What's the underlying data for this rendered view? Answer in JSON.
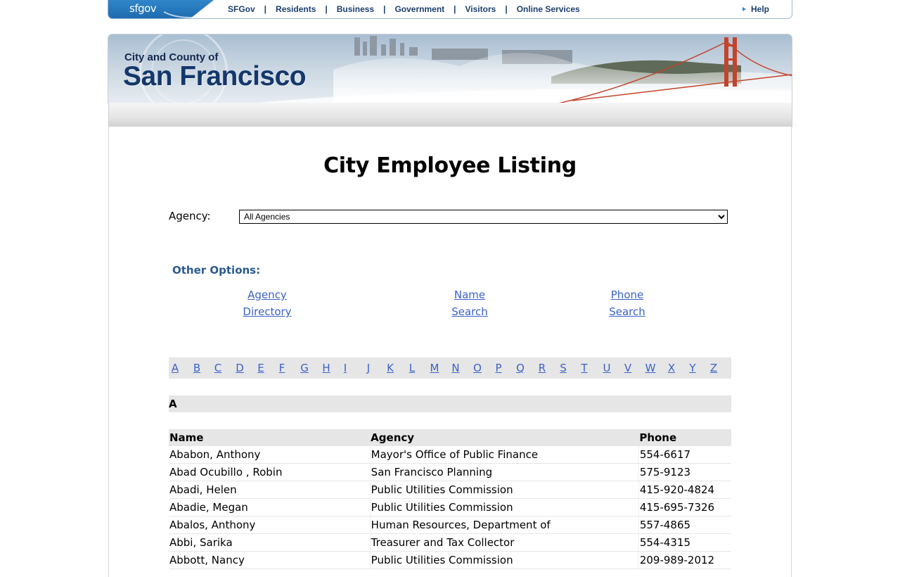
{
  "topnav": {
    "logo_text": "sfgov",
    "items": [
      "SFGov",
      "Residents",
      "Business",
      "Government",
      "Visitors",
      "Online Services"
    ],
    "separator": "|",
    "help_label": "Help"
  },
  "banner": {
    "small_title": "City and County of",
    "big_title": "San Francisco"
  },
  "main": {
    "title": "City Employee Listing",
    "agency_label": "Agency:",
    "agency_selected": "All Agencies",
    "other_options_label": "Other Options:",
    "options": [
      {
        "line1": "Agency",
        "line2": "Directory"
      },
      {
        "line1": "Name",
        "line2": "Search"
      },
      {
        "line1": "Phone",
        "line2": "Search"
      }
    ],
    "alphabet": [
      "A",
      "B",
      "C",
      "D",
      "E",
      "F",
      "G",
      "H",
      "I",
      "J",
      "K",
      "L",
      "M",
      "N",
      "O",
      "P",
      "Q",
      "R",
      "S",
      "T",
      "U",
      "V",
      "W",
      "X",
      "Y",
      "Z"
    ],
    "section_letter": "A",
    "table": {
      "headers": [
        "Name",
        "Agency",
        "Phone"
      ],
      "rows": [
        [
          "Ababon, Anthony",
          "Mayor's Office of Public Finance",
          "554-6617"
        ],
        [
          "Abad Ocubillo , Robin",
          "San Francisco Planning",
          "575-9123"
        ],
        [
          "Abadi, Helen",
          "Public Utilities Commission",
          "415-920-4824"
        ],
        [
          "Abadie, Megan",
          "Public Utilities Commission",
          "415-695-7326"
        ],
        [
          "Abalos, Anthony",
          "Human Resources, Department of",
          "557-4865"
        ],
        [
          "Abbi, Sarika",
          "Treasurer and Tax Collector",
          "554-4315"
        ],
        [
          "Abbott, Nancy",
          "Public Utilities Commission",
          "209-989-2012"
        ]
      ]
    }
  },
  "colors": {
    "link": "#3b62c9",
    "options_heading": "#2b5a8e",
    "bar_gray": "#e6e6e6",
    "nav_text": "#1c3f6e"
  }
}
